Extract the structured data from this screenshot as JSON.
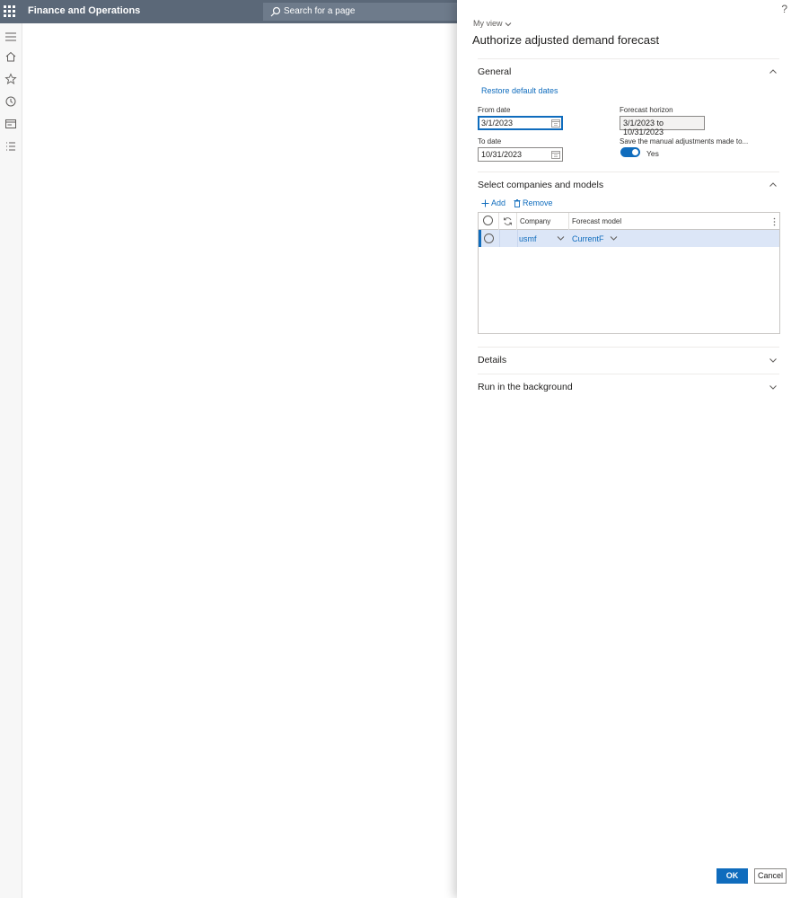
{
  "app": {
    "title": "Finance and Operations"
  },
  "search": {
    "placeholder": "Search for a page"
  },
  "rail": {
    "items": [
      "hamburger-icon",
      "home-icon",
      "favorites-icon",
      "recent-icon",
      "workspaces-icon",
      "modules-icon"
    ]
  },
  "dialog": {
    "help": "?",
    "my_view": "My view",
    "title": "Authorize adjusted demand forecast",
    "general": {
      "header": "General",
      "restore_link": "Restore default dates",
      "from_date_label": "From date",
      "from_date_value": "3/1/2023",
      "to_date_label": "To date",
      "to_date_value": "10/31/2023",
      "forecast_horizon_label": "Forecast horizon",
      "forecast_horizon_value": "3/1/2023 to 10/31/2023",
      "save_manual_label": "Save the manual adjustments made to...",
      "save_manual_value": "Yes"
    },
    "companies": {
      "header": "Select companies and models",
      "add_label": "Add",
      "remove_label": "Remove",
      "columns": [
        "Company",
        "Forecast model"
      ],
      "rows": [
        {
          "company": "usmf",
          "forecast_model": "CurrentF"
        }
      ]
    },
    "details": {
      "header": "Details"
    },
    "background": {
      "header": "Run in the background"
    },
    "ok_label": "OK",
    "cancel_label": "Cancel"
  },
  "colors": {
    "accent": "#0f6cbd",
    "topbar": "#5b6878",
    "row_selected": "#dce6f7"
  }
}
